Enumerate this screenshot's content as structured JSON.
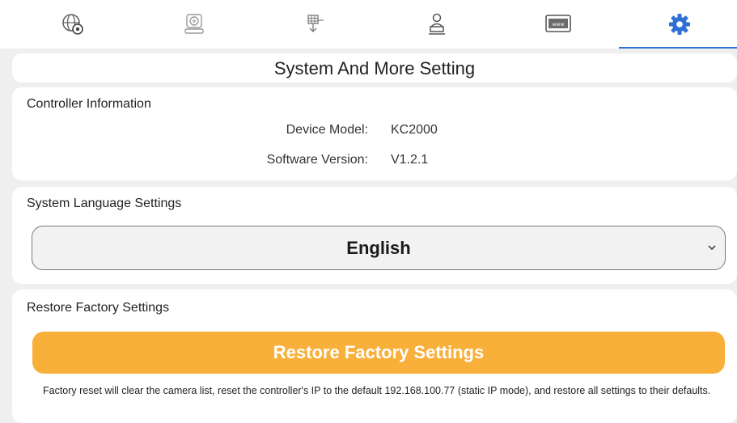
{
  "tabs": [
    {
      "icon": "network-settings-icon"
    },
    {
      "icon": "camera-icon"
    },
    {
      "icon": "keyboard-config-icon"
    },
    {
      "icon": "user-desk-icon"
    },
    {
      "icon": "web-icon"
    },
    {
      "icon": "gear-icon",
      "active": true
    }
  ],
  "page": {
    "title": "System And More Setting"
  },
  "controller_info": {
    "heading": "Controller Information",
    "device_model_label": "Device Model:",
    "device_model_value": "KC2000",
    "software_version_label": "Software Version:",
    "software_version_value": "V1.2.1"
  },
  "language": {
    "heading": "System Language Settings",
    "selected": "English"
  },
  "restore": {
    "heading": "Restore Factory Settings",
    "button_label": "Restore Factory Settings",
    "note": "Factory reset will clear the camera list, reset the controller's IP to the default 192.168.100.77 (static IP mode), and restore all settings to their defaults."
  },
  "colors": {
    "accent": "#2f6fd6",
    "button": "#f9b03b",
    "background": "#efefef"
  }
}
